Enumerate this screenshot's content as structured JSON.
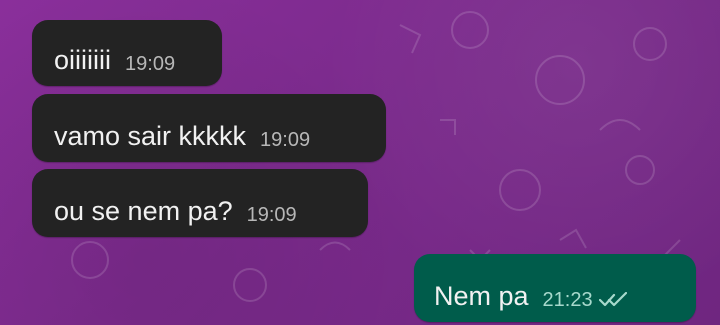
{
  "messages": [
    {
      "text": "oiiiiiii",
      "time": "19:09"
    },
    {
      "text": "vamo sair kkkkk",
      "time": "19:09"
    },
    {
      "text": "ou se nem pa?",
      "time": "19:09"
    },
    {
      "text": "Nem pa",
      "time": "21:23",
      "status_icon": "double-check-icon"
    }
  ],
  "colors": {
    "background": "#7b2a8c",
    "incoming_bubble": "#232323",
    "outgoing_bubble": "#005c4b",
    "read_check": "#a7d9cc"
  }
}
